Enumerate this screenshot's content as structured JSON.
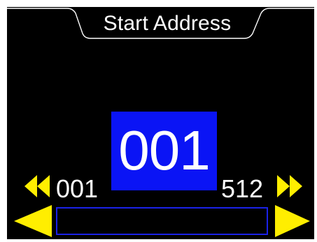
{
  "header": {
    "title": "Start Address"
  },
  "value": {
    "current": "001"
  },
  "range": {
    "min": "001",
    "max": "512"
  },
  "progress": {
    "fraction": 0
  },
  "icons": {
    "fast_left": "fast-rewind-icon",
    "fast_right": "fast-forward-icon",
    "left": "left-arrow-icon",
    "right": "right-arrow-icon"
  },
  "colors": {
    "background": "#000000",
    "accent_blue": "#0a14f5",
    "arrow_yellow": "#ffee00",
    "text": "#ffffff"
  }
}
